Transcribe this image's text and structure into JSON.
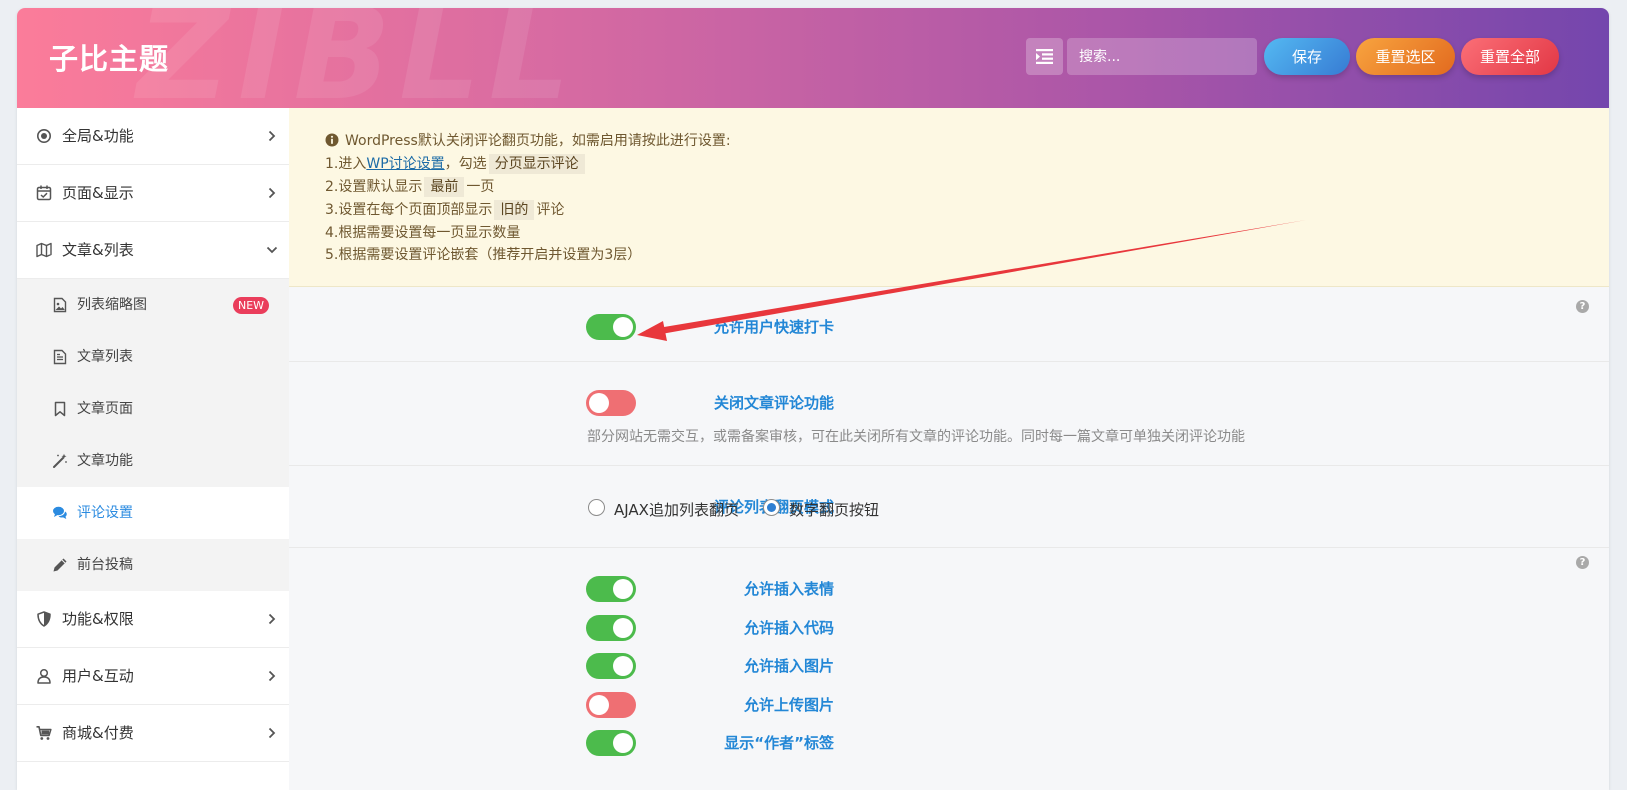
{
  "header": {
    "logo": "子比主题",
    "watermark": "ZIBLL",
    "menu_icon": "list-indent-icon",
    "search_placeholder": "搜索...",
    "buttons": {
      "save": "保存",
      "reset_section": "重置选区",
      "reset_all": "重置全部"
    },
    "colors": {
      "gradient_start": "#fb7c9a",
      "gradient_end": "#7446ad",
      "save": "#4a9ee6",
      "reset_section": "#ef8a30",
      "reset_all": "#f04e5a"
    }
  },
  "sidebar": {
    "items": [
      {
        "label": "全局&功能",
        "icon": "target-icon"
      },
      {
        "label": "页面&显示",
        "icon": "calendar-check-icon"
      },
      {
        "label": "文章&列表",
        "icon": "map-icon",
        "expanded": true
      },
      {
        "label": "功能&权限",
        "icon": "shield-icon"
      },
      {
        "label": "用户&互动",
        "icon": "user-icon"
      },
      {
        "label": "商城&付费",
        "icon": "cart-icon"
      }
    ],
    "subitems": [
      {
        "label": "列表缩略图",
        "icon": "image-icon",
        "badge": "NEW"
      },
      {
        "label": "文章列表",
        "icon": "file-icon"
      },
      {
        "label": "文章页面",
        "icon": "bookmark-icon"
      },
      {
        "label": "文章功能",
        "icon": "magic-wand-icon"
      },
      {
        "label": "评论设置",
        "icon": "comments-icon",
        "active": true
      },
      {
        "label": "前台投稿",
        "icon": "pencil-icon"
      }
    ]
  },
  "notice": {
    "title": "WordPress默认关闭评论翻页功能，如需启用请按此进行设置:",
    "line1_pre": "1.进入",
    "line1_link": "WP讨论设置",
    "line1_mid": "，勾选",
    "line1_code": "分页显示评论",
    "line2_pre": "2.设置默认显示",
    "line2_code": "最前",
    "line2_post": "一页",
    "line3_pre": "3.设置在每个页面顶部显示",
    "line3_code": "旧的",
    "line3_post": "评论",
    "line4": "4.根据需要设置每一页显示数量",
    "line5": "5.根据需要设置评论嵌套（推荐开启并设置为3层）"
  },
  "fields": {
    "quick_checkin": {
      "label": "允许用户快速打卡",
      "on": true
    },
    "close_comments": {
      "label": "关闭文章评论功能",
      "on": false,
      "desc": "部分网站无需交互，或需备案审核，可在此关闭所有文章的评论功能。同时每一篇文章可单独关闭评论功能"
    },
    "pagination_mode": {
      "label": "评论列表翻页模式",
      "options": [
        "AJAX追加列表翻页",
        "数字翻页按钮"
      ],
      "selected": "数字翻页按钮"
    },
    "allow_emoji": {
      "label": "允许插入表情",
      "on": true
    },
    "allow_code": {
      "label": "允许插入代码",
      "on": true
    },
    "allow_image": {
      "label": "允许插入图片",
      "on": true
    },
    "allow_upload": {
      "label": "允许上传图片",
      "on": false
    },
    "show_author_tag": {
      "label": "显示“作者”标签",
      "on": true
    }
  },
  "help_icon": "?",
  "annotation_color": "#e8373c"
}
